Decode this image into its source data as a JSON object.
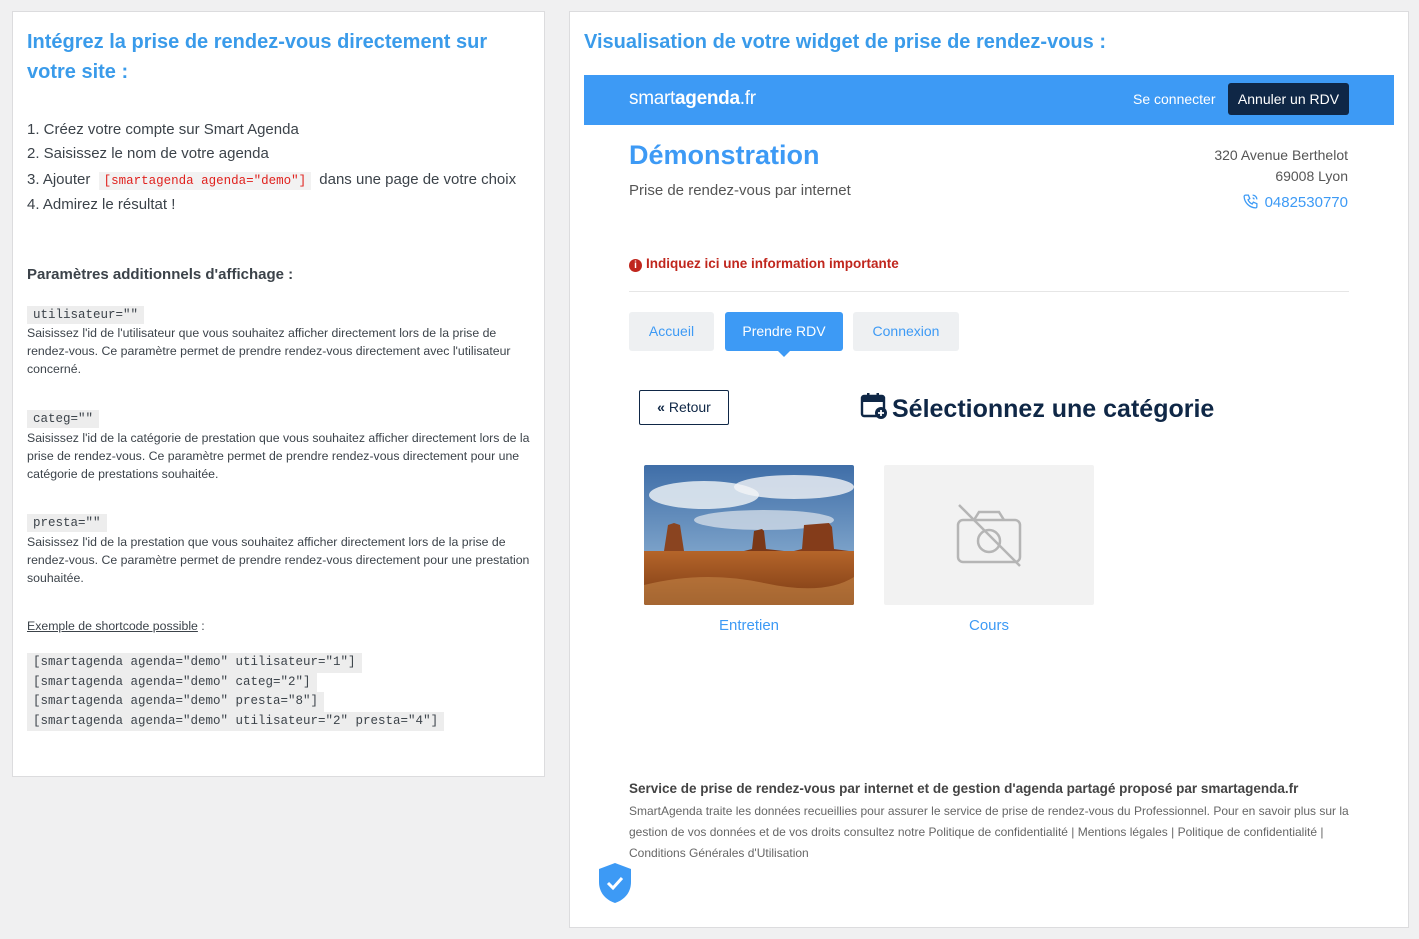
{
  "left": {
    "heading": "Intégrez la prise de rendez-vous directement sur votre site :",
    "steps": [
      "1. Créez votre compte sur Smart Agenda",
      "2. Saisissez le nom de votre agenda",
      "3. Ajouter",
      "dans une page de votre choix",
      "4. Admirez le résultat !"
    ],
    "step3_code": "[smartagenda agenda=\"demo\"]",
    "params_heading": "Paramètres additionnels d'affichage :",
    "params": [
      {
        "code": "utilisateur=\"\"",
        "desc": "Saisissez l'id de l'utilisateur que vous souhaitez afficher directement lors de la prise de rendez-vous. Ce paramètre permet de prendre rendez-vous directement avec l'utilisateur concerné."
      },
      {
        "code": "categ=\"\"",
        "desc": "Saisissez l'id de la catégorie de prestation que vous souhaitez afficher directement lors de la prise de rendez-vous. Ce paramètre permet de prendre rendez-vous directement pour une catégorie de prestations souhaitée."
      },
      {
        "code": "presta=\"\"",
        "desc": "Saisissez l'id de la prestation que vous souhaitez afficher directement lors de la prise de rendez-vous. Ce paramètre permet de prendre rendez-vous directement pour une prestation souhaitée."
      }
    ],
    "example_label": "Exemple de shortcode possible",
    "example_colon": " :",
    "examples": [
      "[smartagenda agenda=\"demo\" utilisateur=\"1\"]",
      "[smartagenda agenda=\"demo\" categ=\"2\"]",
      "[smartagenda agenda=\"demo\" presta=\"8\"]",
      "[smartagenda agenda=\"demo\" utilisateur=\"2\" presta=\"4\"]"
    ]
  },
  "right": {
    "heading": "Visualisation de votre widget de prise de rendez-vous :",
    "widget": {
      "logo_light": "smart",
      "logo_bold": "agenda",
      "logo_tld": ".fr",
      "login_link": "Se connecter",
      "cancel_button": "Annuler un RDV",
      "company_name": "Démonstration",
      "company_subtitle": "Prise de rendez-vous par internet",
      "address_line1": "320 Avenue Berthelot",
      "address_line2": "69008 Lyon",
      "phone": "0482530770",
      "important_notice": "Indiquez ici une information importante",
      "tabs": [
        "Accueil",
        "Prendre RDV",
        "Connexion"
      ],
      "active_tab": "Prendre RDV",
      "back_button": "Retour",
      "section_title": "Sélectionnez une catégorie",
      "categories": [
        "Entretien",
        "Cours"
      ],
      "footer_title": "Service de prise de rendez-vous par internet et de gestion d'agenda partagé proposé par smartagenda.fr",
      "footer_text": "SmartAgenda traite les données recueillies pour assurer le service de prise de rendez-vous du Professionnel. Pour en savoir plus sur la gestion de vos données et de vos droits consultez notre Politique de confidentialité | Mentions légales | Politique de confidentialité | Conditions Générales d'Utilisation"
    },
    "colors": {
      "accent": "#3d9af5",
      "dark": "#0f2746",
      "alert": "#c0261d",
      "heading": "#3a9bea"
    }
  }
}
